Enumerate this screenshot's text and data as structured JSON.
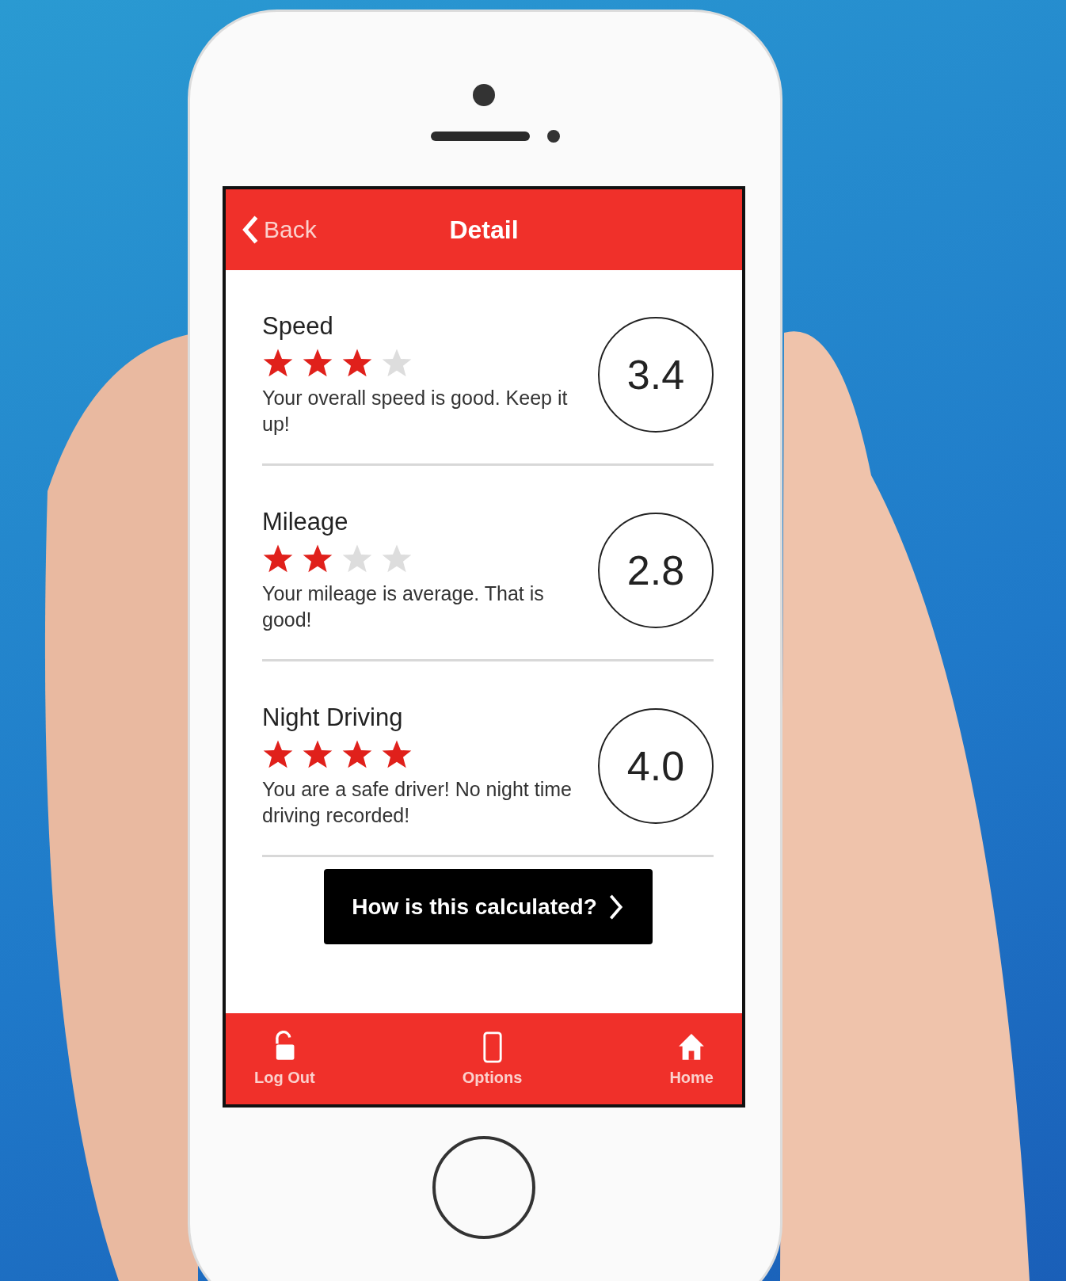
{
  "header": {
    "back": "Back",
    "title": "Detail"
  },
  "scores": [
    {
      "title": "Speed",
      "stars": 3,
      "text": "Your overall speed is good. Keep it up!",
      "score": "3.4"
    },
    {
      "title": "Mileage",
      "stars": 2,
      "text": "Your mileage is average. That is good!",
      "score": "2.8"
    },
    {
      "title": "Night Driving",
      "stars": 4,
      "text": "You are a safe driver! No night time driving recorded!",
      "score": "4.0"
    }
  ],
  "button": {
    "label": "How is this calculated?"
  },
  "tab_bar": [
    {
      "kind": "logout",
      "label": "Log Out"
    },
    {
      "kind": "options",
      "label": "Options"
    },
    {
      "kind": "home",
      "label": "Home"
    }
  ]
}
